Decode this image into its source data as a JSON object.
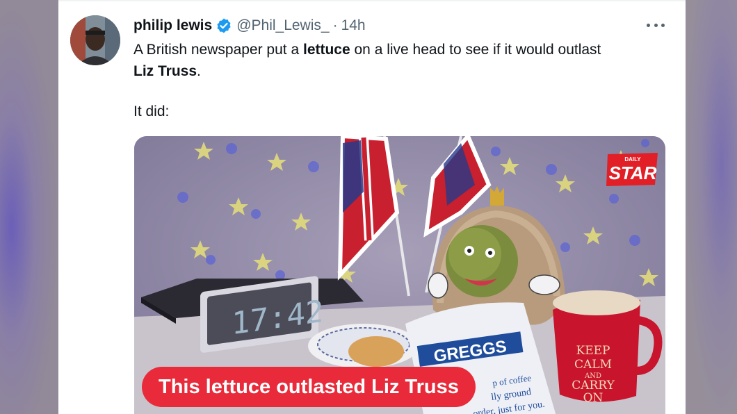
{
  "tweet": {
    "author_name": "philip lewis",
    "handle": "@Phil_Lewis_",
    "separator": "·",
    "time": "14h",
    "text_line1_a": "A British newspaper put a ",
    "text_line1_bold": "lettuce",
    "text_line1_b": " on a live head to see if it would outlast",
    "text_line2_bold": "Liz Truss",
    "text_line2_b": ".",
    "text_line3": "It did:"
  },
  "media": {
    "caption": "This lettuce outlasted Liz Truss",
    "logo_small": "DAILY",
    "logo": "STAR",
    "clock_text": "17:42",
    "bag_brand": "GREGGS",
    "bag_line1": "p of coffee",
    "bag_line2": "lly ground",
    "bag_line3": "order, just for you.",
    "mug_line1": "KEEP",
    "mug_line2": "CALM",
    "mug_line3": "AND",
    "mug_line4": "CARRY",
    "mug_line5": "ON"
  },
  "colors": {
    "verified_badge": "#1d9bf0",
    "caption_bg": "#e92a3a",
    "text_primary": "#0f1419",
    "text_secondary": "#536471"
  },
  "icons": {
    "verified": "verified-badge-icon",
    "more": "more-options-icon"
  }
}
